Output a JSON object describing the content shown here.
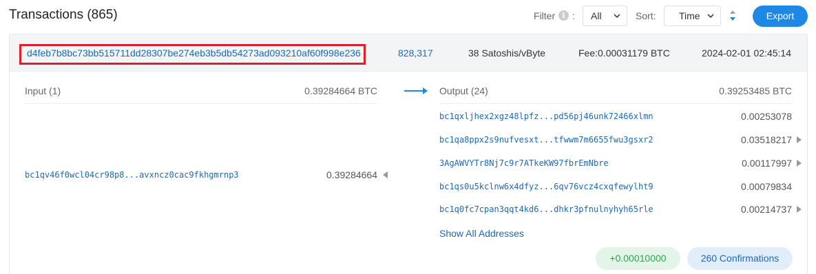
{
  "header": {
    "title": "Transactions (865)",
    "filter_label": "Filter",
    "info_glyph": "i",
    "colon": ":",
    "filter_value": "All",
    "sort_label": "Sort:",
    "sort_value": "Time",
    "export_label": "Export"
  },
  "transaction": {
    "hash": "d4feb7b8bc73bb515711dd28307be274eb3b5db54273ad093210af60f998e236",
    "block": "828,317",
    "fee_rate": "38 Satoshis/vByte",
    "fee": "Fee:0.00031179 BTC",
    "time": "2024-02-01 02:45:14",
    "input_label": "Input (1)",
    "input_total": "0.39284664 BTC",
    "output_label": "Output (24)",
    "output_total": "0.39253485 BTC",
    "inputs": [
      {
        "address": "bc1qv46f0wcl04cr98p8...avxncz0cac9fkhgmrnp3",
        "amount": "0.39284664"
      }
    ],
    "outputs": [
      {
        "address": "bc1qxljhex2xgz48lpfz...pd56pj46unk72466xlmn",
        "amount": "0.00253078",
        "expandable": false
      },
      {
        "address": "bc1qa8ppx2s9nufvesxt...tfwwm7m6655fwu3gsxr2",
        "amount": "0.03518217",
        "expandable": true
      },
      {
        "address": "3AgAWVYTr8Nj7c9r7ATkeKW97fbrEmNbre",
        "amount": "0.00117997",
        "expandable": true
      },
      {
        "address": "bc1qs0u5kclnw6x4dfyz...6qv76vcz4cxqfewylht9",
        "amount": "0.00079834",
        "expandable": false
      },
      {
        "address": "bc1q0fc7cpan3qqt4kd6...dhkr3pfnulnyhyh65rle",
        "amount": "0.00214737",
        "expandable": true
      }
    ],
    "show_all": "Show All Addresses",
    "balance_change": "+0.00010000",
    "confirmations": "260 Confirmations"
  },
  "colors": {
    "accent": "#1e88e5",
    "link": "#1c69b8",
    "highlight_border": "#e01e26",
    "positive": "#2aa84a"
  },
  "icons": {
    "info": "info-icon",
    "filter_chevron": "chevron-down-icon",
    "sort_chevron": "chevron-down-icon",
    "sort_direction": "sort-arrows-icon",
    "flow": "arrow-right-icon",
    "input_expand": "triangle-left-icon",
    "output_expand": "triangle-right-icon"
  }
}
